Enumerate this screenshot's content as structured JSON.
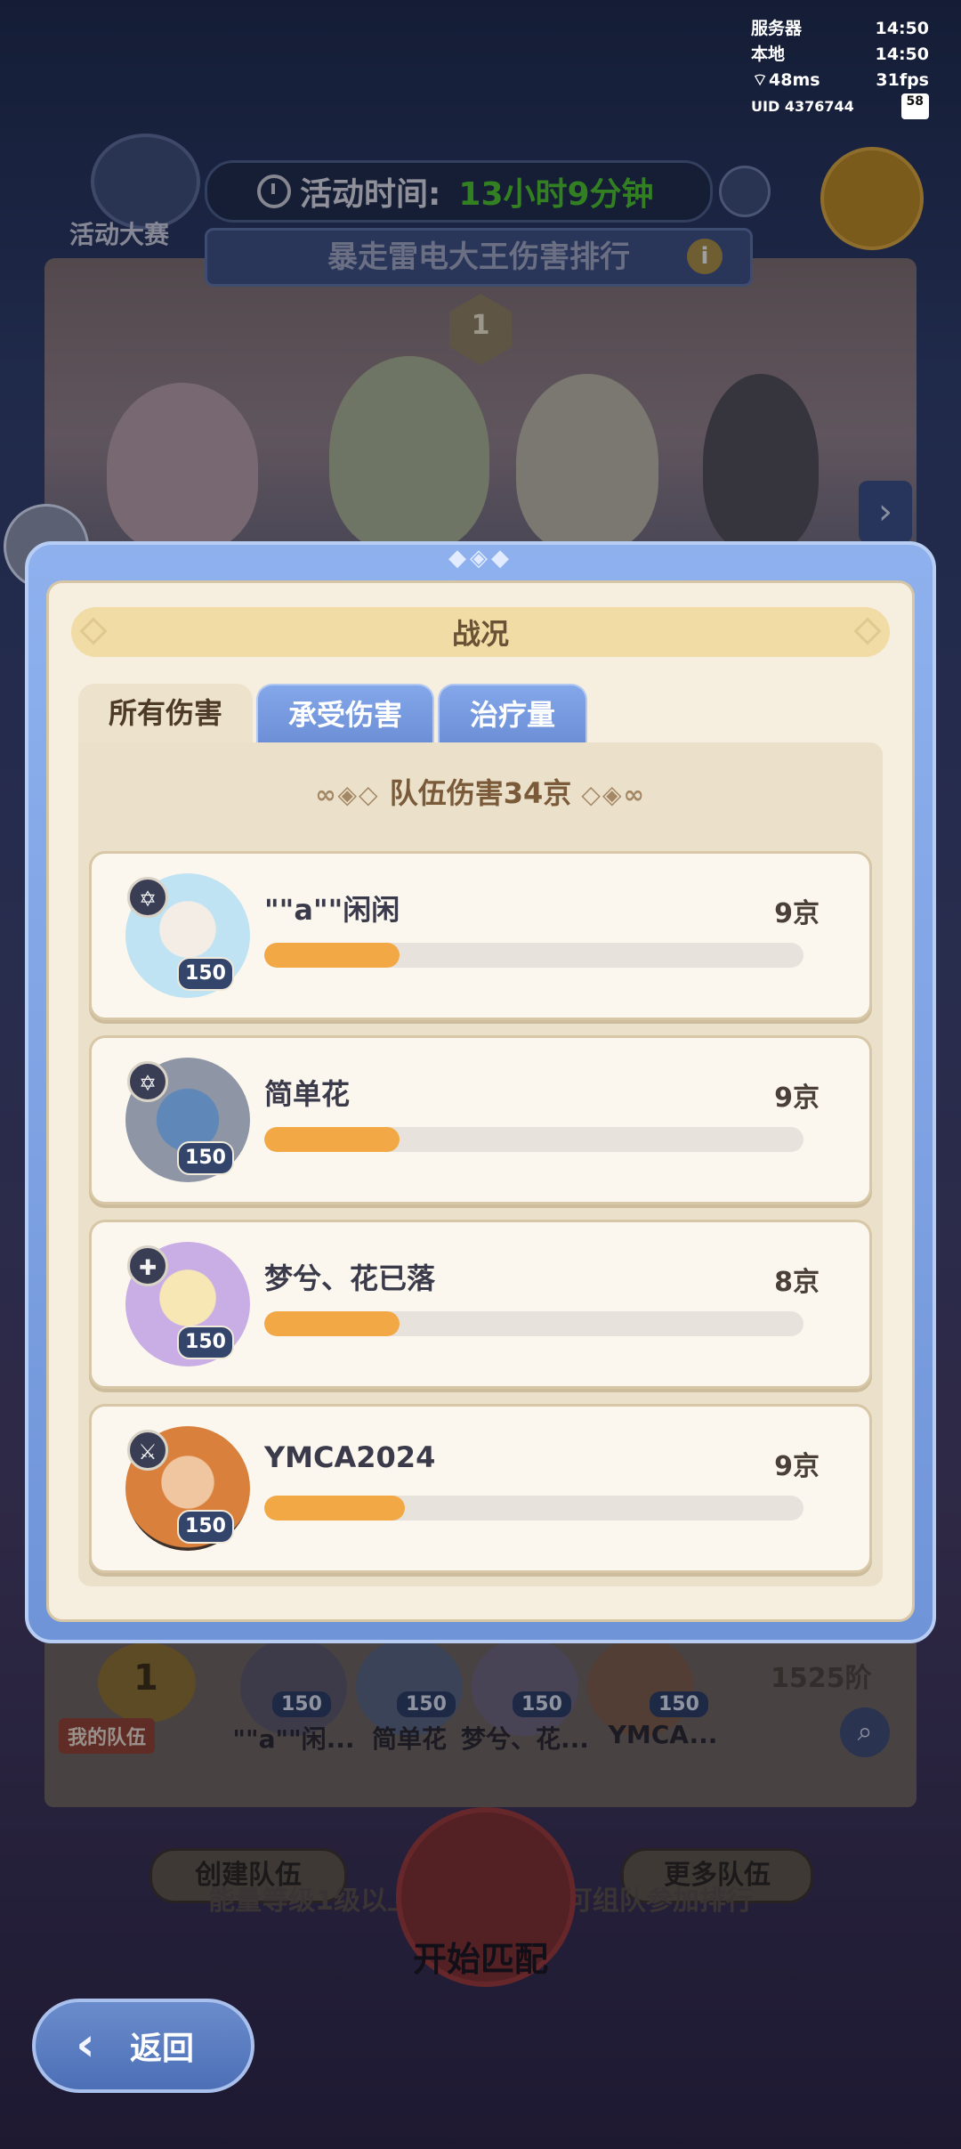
{
  "status": {
    "server_label": "服务器",
    "server_time": "14:50",
    "local_label": "本地",
    "local_time": "14:50",
    "ping": "48ms",
    "fps": "31fps",
    "uid_label": "UID",
    "uid": "4376744",
    "battery": "58"
  },
  "event": {
    "shop_label": "活动大赛",
    "time_label": "活动时间:",
    "time_value": "13小时9分钟",
    "title": "暴走雷电大王伤害排行",
    "rank_number": "1"
  },
  "team_strip": {
    "rank_number": "1",
    "my_team_label": "我的队伍",
    "score": "1525阶",
    "members": [
      {
        "name": "\"\"a\"\"闲...",
        "level": "150"
      },
      {
        "name": "简单花",
        "level": "150"
      },
      {
        "name": "梦兮、花...",
        "level": "150"
      },
      {
        "name": "YMCA...",
        "level": "150"
      }
    ],
    "tip": "能量等级1级以上等级1级以下可组队参加排行",
    "create_team": "创建队伍",
    "more_teams": "更多队伍",
    "start_match": "开始匹配"
  },
  "back_label": "返回",
  "modal": {
    "title": "战况",
    "tabs": [
      {
        "label": "所有伤害",
        "active": true
      },
      {
        "label": "承受伤害",
        "active": false
      },
      {
        "label": "治疗量",
        "active": false
      }
    ],
    "team_total": "队伍伤害34京",
    "players": [
      {
        "name": "\"\"a\"\"闲闲",
        "value": "9京",
        "level": "150",
        "class_icon": "star-of-david-icon",
        "share": 0.25,
        "color": "#bfe3f2"
      },
      {
        "name": "简单花",
        "value": "9京",
        "level": "150",
        "class_icon": "star-of-david-icon",
        "share": 0.25,
        "color": "#7fa3c9"
      },
      {
        "name": "梦兮、花已落",
        "value": "8京",
        "level": "150",
        "class_icon": "cross-icon",
        "share": 0.25,
        "color": "#e7c6e9"
      },
      {
        "name": "YMCA2024",
        "value": "9京",
        "level": "150",
        "class_icon": "sword-icon",
        "share": 0.26,
        "color": "#d9803c"
      }
    ]
  },
  "colors": {
    "accent_blue": "#6f94d8",
    "bar_orange": "#f2a945",
    "timer_green": "#4bbf2a"
  }
}
